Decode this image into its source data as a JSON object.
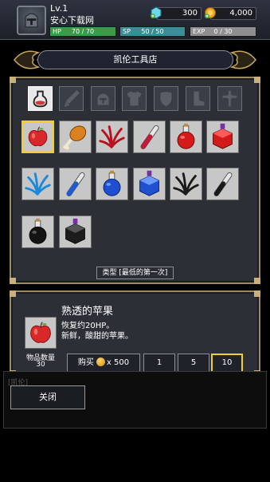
{
  "player": {
    "level": "Lv.1",
    "name": "安心下载网",
    "hp_label": "HP",
    "hp": "70 / 70",
    "sp_label": "SP",
    "sp": "50 / 50",
    "exp_label": "EXP",
    "exp": "0 / 30",
    "gems": "300",
    "coins": "4,000"
  },
  "shop": {
    "title": "凯伦工具店",
    "sort_label": "类型 [最低的第一次]",
    "tabs": [
      {
        "icon": "potion-icon",
        "active": true
      },
      {
        "icon": "sword-icon",
        "active": false
      },
      {
        "icon": "helmet-icon",
        "active": false
      },
      {
        "icon": "armor-icon",
        "active": false
      },
      {
        "icon": "shield-icon",
        "active": false
      },
      {
        "icon": "boots-icon",
        "active": false
      },
      {
        "icon": "accessory-icon",
        "active": false
      }
    ],
    "items": [
      {
        "icon": "apple-icon",
        "selected": true
      },
      {
        "icon": "meat-icon"
      },
      {
        "icon": "red-herb-icon"
      },
      {
        "icon": "red-vial-icon"
      },
      {
        "icon": "red-flask-icon"
      },
      {
        "icon": "red-box-potion-icon"
      },
      {
        "icon": "blue-herb-icon"
      },
      {
        "icon": "blue-vial-icon"
      },
      {
        "icon": "blue-flask-icon"
      },
      {
        "icon": "blue-box-potion-icon"
      },
      {
        "icon": "black-herb-icon"
      },
      {
        "icon": "black-vial-icon"
      },
      {
        "icon": "black-flask-icon"
      },
      {
        "icon": "black-box-potion-icon"
      }
    ]
  },
  "detail": {
    "name": "熟透的苹果",
    "desc_1": "恢复约20HP。",
    "desc_2": "新鲜，酸甜的苹果。",
    "qty_label": "物品数量",
    "qty_value": "30",
    "buy_label": "购买",
    "price": "x 500",
    "qty_options": [
      "1",
      "5",
      "10"
    ],
    "selected_qty": "10"
  },
  "bottom": {
    "underlay_text": "[凯伦]",
    "close_label": "关闭"
  },
  "colors": {
    "hp": "#3b9a48",
    "sp": "#3a8e98",
    "exp": "#8f8f8f",
    "frame": "#9c8a62",
    "selected": "#f2d02c"
  }
}
